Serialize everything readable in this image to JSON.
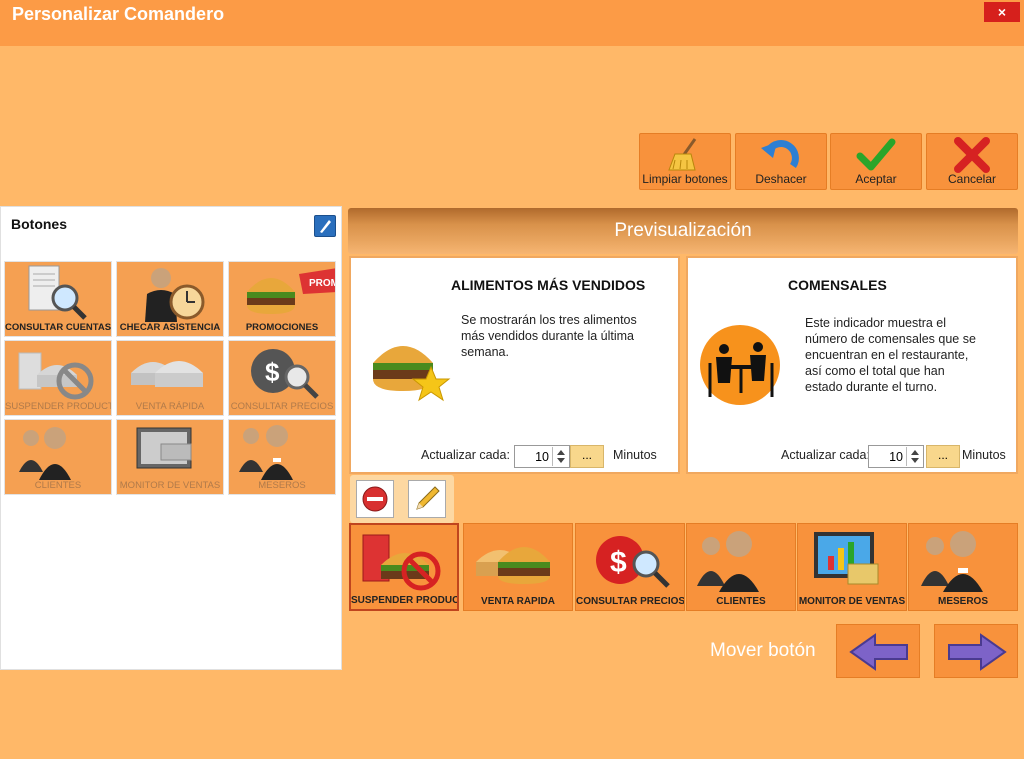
{
  "window": {
    "title": "Personalizar Comandero",
    "close_label": "×"
  },
  "toolbar": [
    {
      "label": "Limpiar botones",
      "icon": "broom-icon"
    },
    {
      "label": "Deshacer",
      "icon": "undo-icon"
    },
    {
      "label": "Aceptar",
      "icon": "check-icon"
    },
    {
      "label": "Cancelar",
      "icon": "cancel-x-icon"
    }
  ],
  "left_panel": {
    "title": "Botones",
    "help_icon": "help-icon",
    "buttons": [
      {
        "label": "CONSULTAR CUENTAS",
        "icon": "receipt-search-icon",
        "disabled": false
      },
      {
        "label": "CHECAR ASISTENCIA",
        "icon": "clock-waiter-icon",
        "disabled": false
      },
      {
        "label": "PROMOCIONES",
        "icon": "burger-promo-icon",
        "disabled": false,
        "badge": "PROM"
      },
      {
        "label": "SUSPENDER PRODUCTO",
        "icon": "suspend-product-icon",
        "disabled": true
      },
      {
        "label": "VENTA RÁPIDA",
        "icon": "burger-icon",
        "disabled": true
      },
      {
        "label": "CONSULTAR PRECIOS",
        "icon": "price-search-icon",
        "disabled": true
      },
      {
        "label": "CLIENTES",
        "icon": "clients-icon",
        "disabled": true
      },
      {
        "label": "MONITOR DE VENTAS",
        "icon": "sales-monitor-icon",
        "disabled": true
      },
      {
        "label": "MESEROS",
        "icon": "waiters-icon",
        "disabled": true
      }
    ]
  },
  "preview": {
    "header": "Previsualización",
    "cards": [
      {
        "title": "ALIMENTOS MÁS VENDIDOS",
        "description": "Se mostrarán los tres alimentos\nmás vendidos durante la última\nsemana.",
        "update_label": "Actualizar cada:",
        "update_value": "10",
        "ellipsis": "...",
        "unit": "Minutos",
        "icon": "burger-star-icon"
      },
      {
        "title": "COMENSALES",
        "description": "Este indicador muestra el\nnúmero de comensales que se\nencuentran en el restaurante,\nasí como el total que han\nestado durante el turno.",
        "update_label": "Actualizar cada:",
        "update_value": "10",
        "ellipsis": "...",
        "unit": "Minutos",
        "icon": "diners-icon"
      }
    ],
    "edit_popup": [
      {
        "icon": "remove-icon"
      },
      {
        "icon": "pencil-icon"
      }
    ],
    "selected_buttons": [
      {
        "label": "SUSPENDER PRODUCTO",
        "icon": "suspend-product-icon",
        "active": true
      },
      {
        "label": "VENTA RÁPIDA",
        "icon": "burger-icon",
        "active": false
      },
      {
        "label": "CONSULTAR PRECIOS",
        "icon": "price-search-icon",
        "active": false
      },
      {
        "label": "CLIENTES",
        "icon": "clients-icon",
        "active": false
      },
      {
        "label": "MONITOR DE VENTAS",
        "icon": "sales-monitor-icon",
        "active": false
      },
      {
        "label": "MESEROS",
        "icon": "waiters-icon",
        "active": false
      }
    ],
    "move_label": "Mover botón",
    "move_left_icon": "arrow-left-icon",
    "move_right_icon": "arrow-right-icon"
  },
  "colors": {
    "background": "#ffb868",
    "titlebar": "#fc9b46",
    "button": "#f8923c",
    "close": "#d6201c"
  }
}
